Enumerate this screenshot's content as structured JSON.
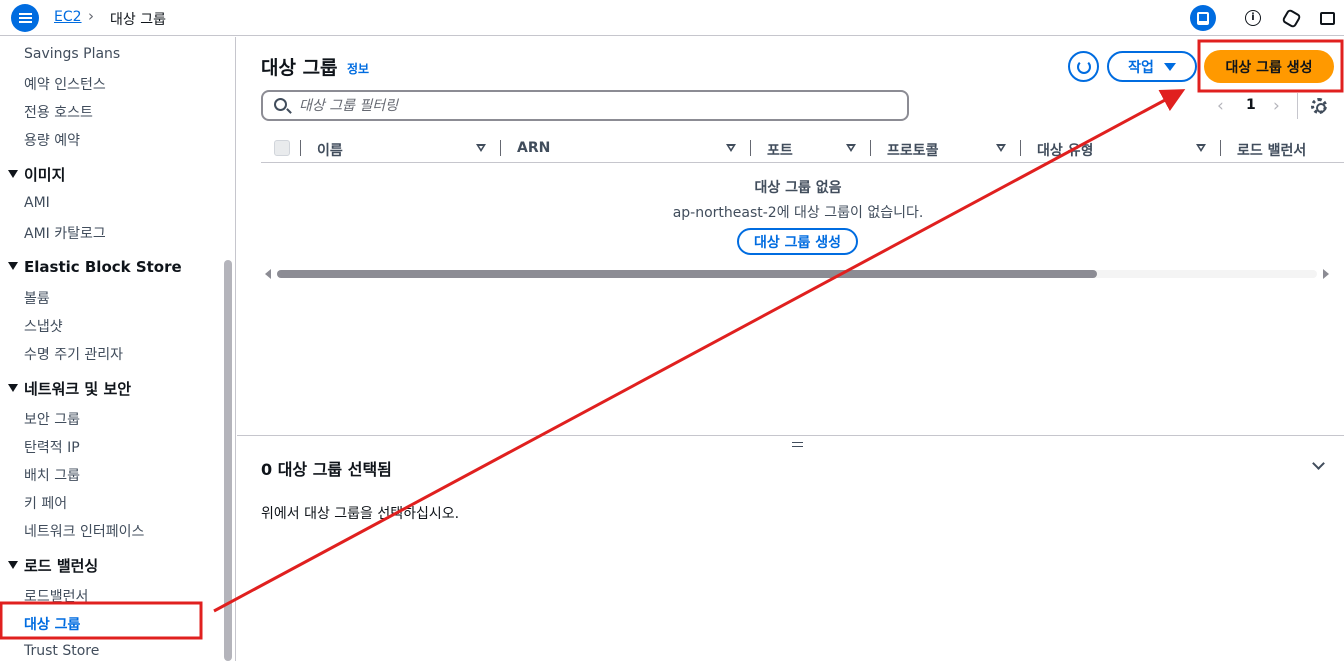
{
  "topbar": {
    "breadcrumb_service": "EC2",
    "breadcrumb_separator": "›",
    "breadcrumb_current": "대상 그룹"
  },
  "sidebar": {
    "items": [
      {
        "label": "Savings Plans",
        "type": "item"
      },
      {
        "label": "예약 인스턴스",
        "type": "item"
      },
      {
        "label": "전용 호스트",
        "type": "item"
      },
      {
        "label": "용량 예약",
        "type": "item"
      },
      {
        "label": "이미지",
        "type": "section"
      },
      {
        "label": "AMI",
        "type": "item"
      },
      {
        "label": "AMI 카탈로그",
        "type": "item"
      },
      {
        "label": "Elastic Block Store",
        "type": "section"
      },
      {
        "label": "볼륨",
        "type": "item"
      },
      {
        "label": "스냅샷",
        "type": "item"
      },
      {
        "label": "수명 주기 관리자",
        "type": "item"
      },
      {
        "label": "네트워크 및 보안",
        "type": "section"
      },
      {
        "label": "보안 그룹",
        "type": "item"
      },
      {
        "label": "탄력적 IP",
        "type": "item"
      },
      {
        "label": "배치 그룹",
        "type": "item"
      },
      {
        "label": "키 페어",
        "type": "item"
      },
      {
        "label": "네트워크 인터페이스",
        "type": "item"
      },
      {
        "label": "로드 밸런싱",
        "type": "section"
      },
      {
        "label": "로드밸런서",
        "type": "item"
      },
      {
        "label": "대상 그룹",
        "type": "item",
        "active": true
      },
      {
        "label": "Trust Store",
        "type": "item"
      }
    ]
  },
  "main": {
    "title": "대상 그룹",
    "info_link": "정보",
    "actions_label": "작업",
    "create_label": "대상 그룹 생성",
    "search_placeholder": "대상 그룹 필터링",
    "pager_prev": "‹",
    "page_number": "1",
    "pager_next": "›",
    "columns": [
      "이름",
      "ARN",
      "포트",
      "프로토콜",
      "대상 유형",
      "로드 밸런서"
    ],
    "empty_title": "대상 그룹 없음",
    "empty_description": "ap-northeast-2에 대상 그룹이 없습니다.",
    "empty_create_label": "대상 그룹 생성"
  },
  "detail": {
    "title": "0 대상 그룹 선택됨",
    "message": "위에서 대상 그룹을 선택하십시오."
  },
  "colors": {
    "accent": "#006ce0",
    "primary_button": "#ff9900",
    "annotation": "#e0201f"
  },
  "icons": [
    "menu-icon",
    "chevron-right-icon",
    "panel-icon",
    "info-icon",
    "hexagon-icon",
    "terminal-icon",
    "refresh-icon",
    "caret-down-icon",
    "search-icon",
    "settings-icon",
    "chevron-down-icon"
  ]
}
